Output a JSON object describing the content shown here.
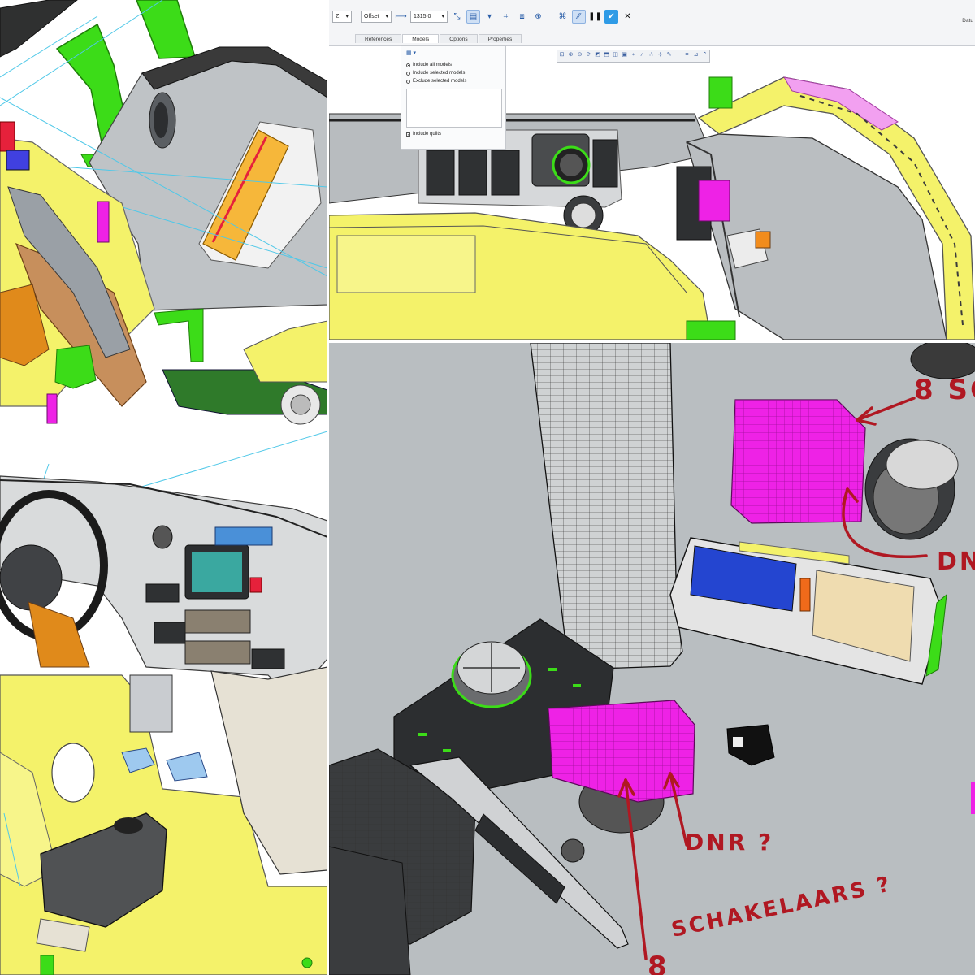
{
  "ribbon": {
    "axis_value": "Z",
    "depth_type": "Offset",
    "depth_value": "1315.0",
    "datum_label": "Datu",
    "tabs": [
      {
        "label": "References"
      },
      {
        "label": "Models"
      },
      {
        "label": "Options"
      },
      {
        "label": "Properties"
      }
    ],
    "selected_tab": "Models"
  },
  "models_panel": {
    "options": [
      {
        "label": "Include all models",
        "selected": true
      },
      {
        "label": "Include selected models",
        "selected": false
      },
      {
        "label": "Exclude selected models",
        "selected": false
      }
    ],
    "include_quilts_label": "Include quilts",
    "include_quilts_checked": true
  },
  "annotations": {
    "top_right": "8 SC",
    "right_dnr": "DN",
    "dnr_question": "DNR ?",
    "switches_question": "SCHAKELAARS ?",
    "switches_number": "8"
  },
  "colors": {
    "accent_green": "#3cdc18",
    "highlight_magenta": "#ee22e6",
    "cad_yellow": "#f4f26a",
    "annotation_red": "#b01822",
    "viewport_gray": "#b9bec1"
  }
}
